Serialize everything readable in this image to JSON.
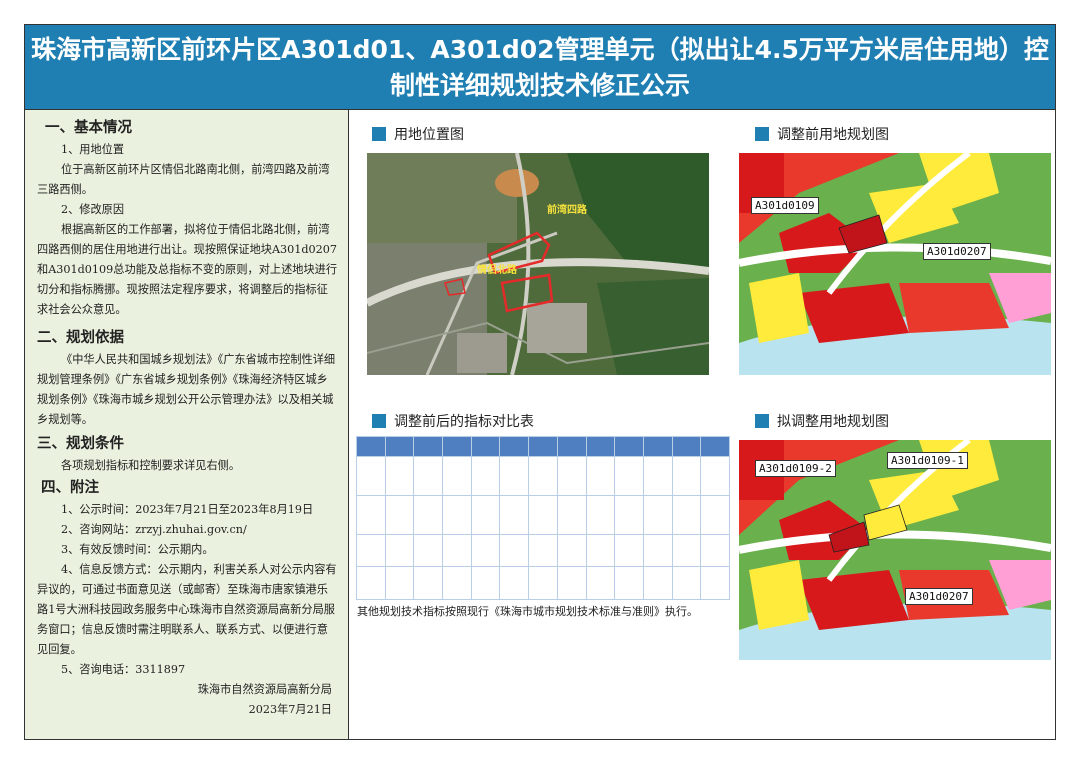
{
  "title": "珠海市高新区前环片区A301d01、A301d02管理单元（拟出让4.5万平方米居住用地）控制性详细规划技术修正公示",
  "left": {
    "s1_title": "一、基本情况",
    "s1_1_title": "1、用地位置",
    "s1_1_text": "位于高新区前环片区情侣北路南北侧，前湾四路及前湾三路西侧。",
    "s1_2_title": "2、修改原因",
    "s1_2_text": "根据高新区的工作部署，拟将位于情侣北路北侧，前湾四路西侧的居住用地进行出让。现按照保证地块A301d0207和A301d0109总功能及总指标不变的原则，对上述地块进行切分和指标腾挪。现按照法定程序要求，将调整后的指标征求社会公众意见。",
    "s2_title": "二、规划依据",
    "s2_text": "《中华人民共和国城乡规划法》《广东省城市控制性详细规划管理条例》《广东省城乡规划条例》《珠海经济特区城乡规划条例》《珠海市城乡规划公开公示管理办法》以及相关城乡规划等。",
    "s3_title": "三、规划条件",
    "s3_text": "各项规划指标和控制要求详见右侧。",
    "s4_title": "四、附注",
    "s4_1": "1、公示时间：2023年7月21日至2023年8月19日",
    "s4_2": "2、咨询网站：zrzyj.zhuhai.gov.cn/",
    "s4_3": "3、有效反馈时间：公示期内。",
    "s4_4": "4、信息反馈方式：公示期内，利害关系人对公示内容有异议的，可通过书面意见送（或邮寄）至珠海市唐家镇港乐路1号大洲科技园政务服务中心珠海市自然资源局高新分局服务窗口；信息反馈时需注明联系人、联系方式、以便进行意见回复。",
    "s4_5": "5、咨询电话：3311897",
    "signer": "珠海市自然资源局高新分局",
    "date": "2023年7月21日"
  },
  "panels": {
    "location_title": "用地位置图",
    "before_title": "调整前用地规划图",
    "table_title": "调整前后的指标对比表",
    "after_title": "拟调整用地规划图",
    "note": "其他规划技术指标按照现行《珠海市城市规划技术标准与准则》执行。"
  },
  "map_labels": {
    "before_a": "A301d0109",
    "before_b": "A301d0207",
    "after_a": "A301d0109-2",
    "after_b": "A301d0109-1",
    "after_c": "A301d0207"
  },
  "colors": {
    "header": "#1f7fb2",
    "left_bg": "#eaf1df",
    "residential": "#ffeb3b",
    "commercial": "#d7191c",
    "green": "#7cc242",
    "water": "#b9e3ef"
  }
}
